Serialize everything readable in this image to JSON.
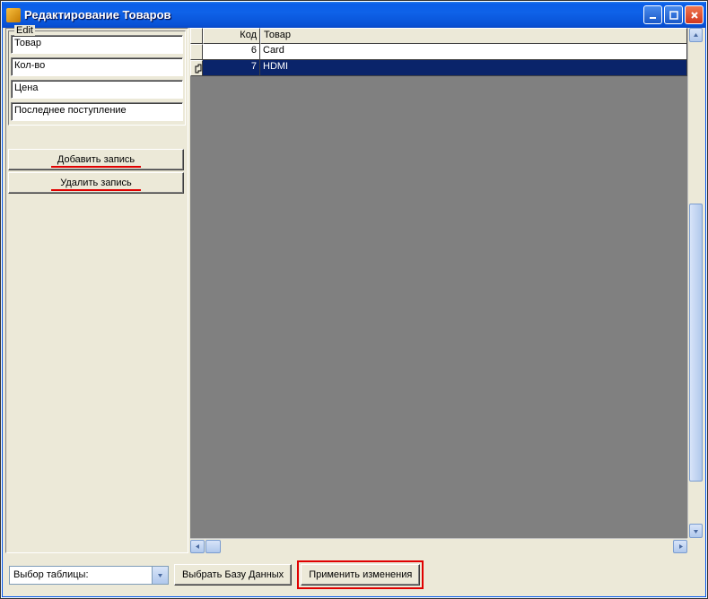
{
  "window": {
    "title": "Редактирование Товаров"
  },
  "sidebar": {
    "legend": "Edit",
    "fields": {
      "tovar": "Товар",
      "kolvo": "Кол-во",
      "cena": "Цена",
      "last": "Последнее поступление"
    },
    "add_label": "Добавить запись",
    "del_label": "Удалить запись"
  },
  "grid": {
    "headers": {
      "kod": "Код",
      "tovar": "Товар"
    },
    "rows": [
      {
        "kod": "6",
        "tovar": "Card",
        "selected": false
      },
      {
        "kod": "7",
        "tovar": "HDMI",
        "selected": true
      }
    ]
  },
  "bottom": {
    "combo_label": "Выбор таблицы:",
    "choose_db": "Выбрать Базу Данных",
    "apply": "Применить изменения"
  }
}
